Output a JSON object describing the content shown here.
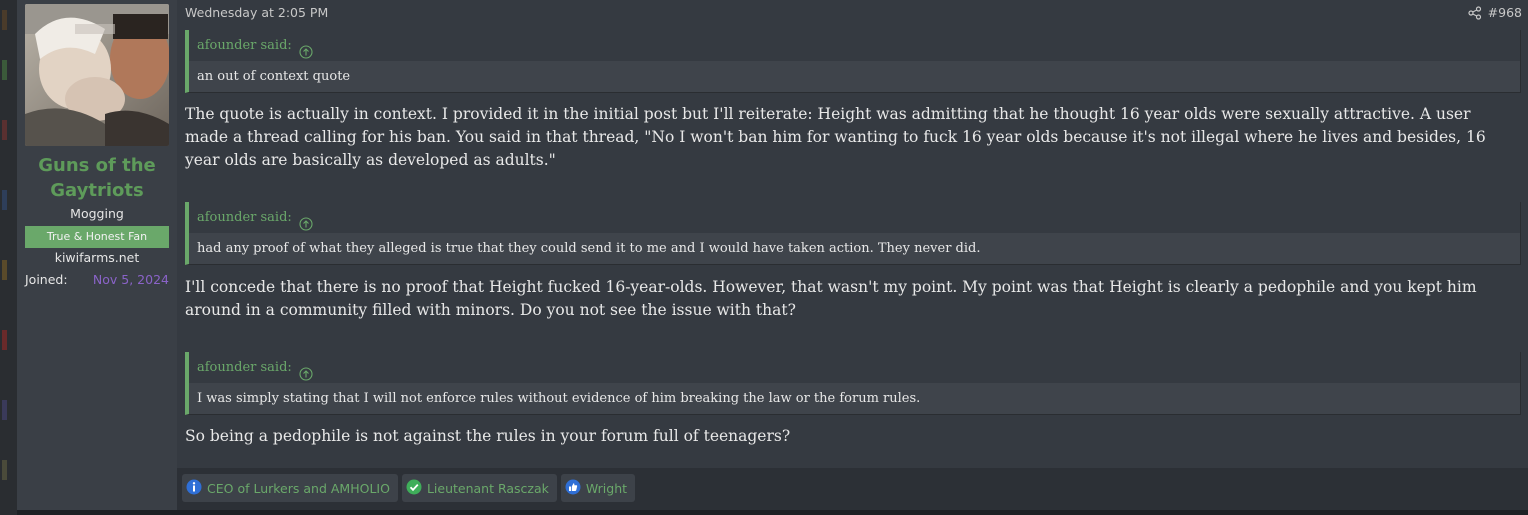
{
  "user": {
    "username": "Guns of the Gaytriots",
    "title": "Mogging",
    "banner": "True & Honest Fan",
    "site": "kiwifarms.net",
    "joined_label": "Joined:",
    "joined_value": "Nov 5, 2024"
  },
  "post": {
    "date": "Wednesday at 2:05 PM",
    "number": "#968",
    "quotes": [
      {
        "author": "afounder said:",
        "text": "an out of context quote"
      },
      {
        "author": "afounder said:",
        "text": "had any proof of what they alleged is true that they could send it to me and I would have taken action. They never did."
      },
      {
        "author": "afounder said:",
        "text": "I was simply stating that I will not enforce rules without evidence of him breaking the law or the forum rules."
      }
    ],
    "paragraphs": [
      "The quote is actually in context. I provided it in the initial post but I'll reiterate: Height was admitting that he thought 16 year olds were sexually attractive. A user made a thread calling for his ban. You said in that thread, \"No I won't ban him for wanting to fuck 16 year olds because it's not illegal where he lives and besides, 16 year olds are basically as developed as adults.\"",
      "I'll concede that there is no proof that Height fucked 16-year-olds. However, that wasn't my point. My point was that Height is clearly a pedophile and you kept him around in a community filled with minors. Do you not see the issue with that?",
      "So being a pedophile is not against the rules in your forum full of teenagers?"
    ]
  },
  "reactions": [
    {
      "icon": "info-icon",
      "label": "CEO of Lurkers and AMHOLIO"
    },
    {
      "icon": "check-icon",
      "label": "Lieutenant Rasczak"
    },
    {
      "icon": "thumbs-up-icon",
      "label": "Wright"
    }
  ],
  "colors": {
    "accent_green": "#6aa86a",
    "joined_purple": "#8a63c8",
    "info_blue": "#2f6fd6"
  }
}
